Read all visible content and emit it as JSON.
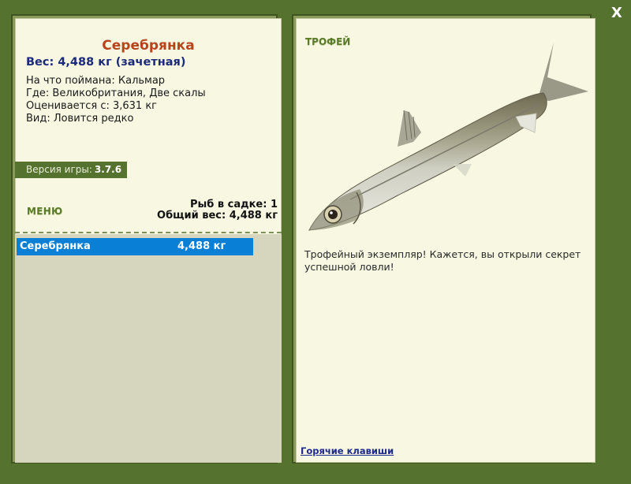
{
  "window": {
    "close_label": "X"
  },
  "fish": {
    "name": "Серебрянка",
    "weight_line": "Вес: 4,488 кг (зачетная)",
    "bait_line": "На что поймана: Кальмар",
    "location_line": "Где: Великобритания, Две скалы",
    "min_weight_line": "Оценивается с: 3,631 кг",
    "rarity_line": "Вид: Ловится редко"
  },
  "version": {
    "label": "Версия игры:",
    "value": "3.7.6"
  },
  "menu": {
    "label": "МЕНЮ"
  },
  "keepnet": {
    "count_line": "Рыб в садке: 1",
    "total_line": "Общий вес: 4,488 кг",
    "items": [
      {
        "name": "Серебрянка",
        "weight": "4,488 кг"
      }
    ]
  },
  "trophy": {
    "label": "ТРОФЕЙ",
    "description": "Трофейный экземпляр! Кажется, вы открыли секрет успешной ловли!"
  },
  "footer": {
    "hotkeys_label": "Горячие клавиши"
  },
  "colors": {
    "background": "#56722f",
    "panel": "#f7f7e2",
    "title": "#b7441a",
    "weight": "#1c2a7a",
    "selection": "#0a7fd6",
    "accent_label": "#5a7a28"
  }
}
